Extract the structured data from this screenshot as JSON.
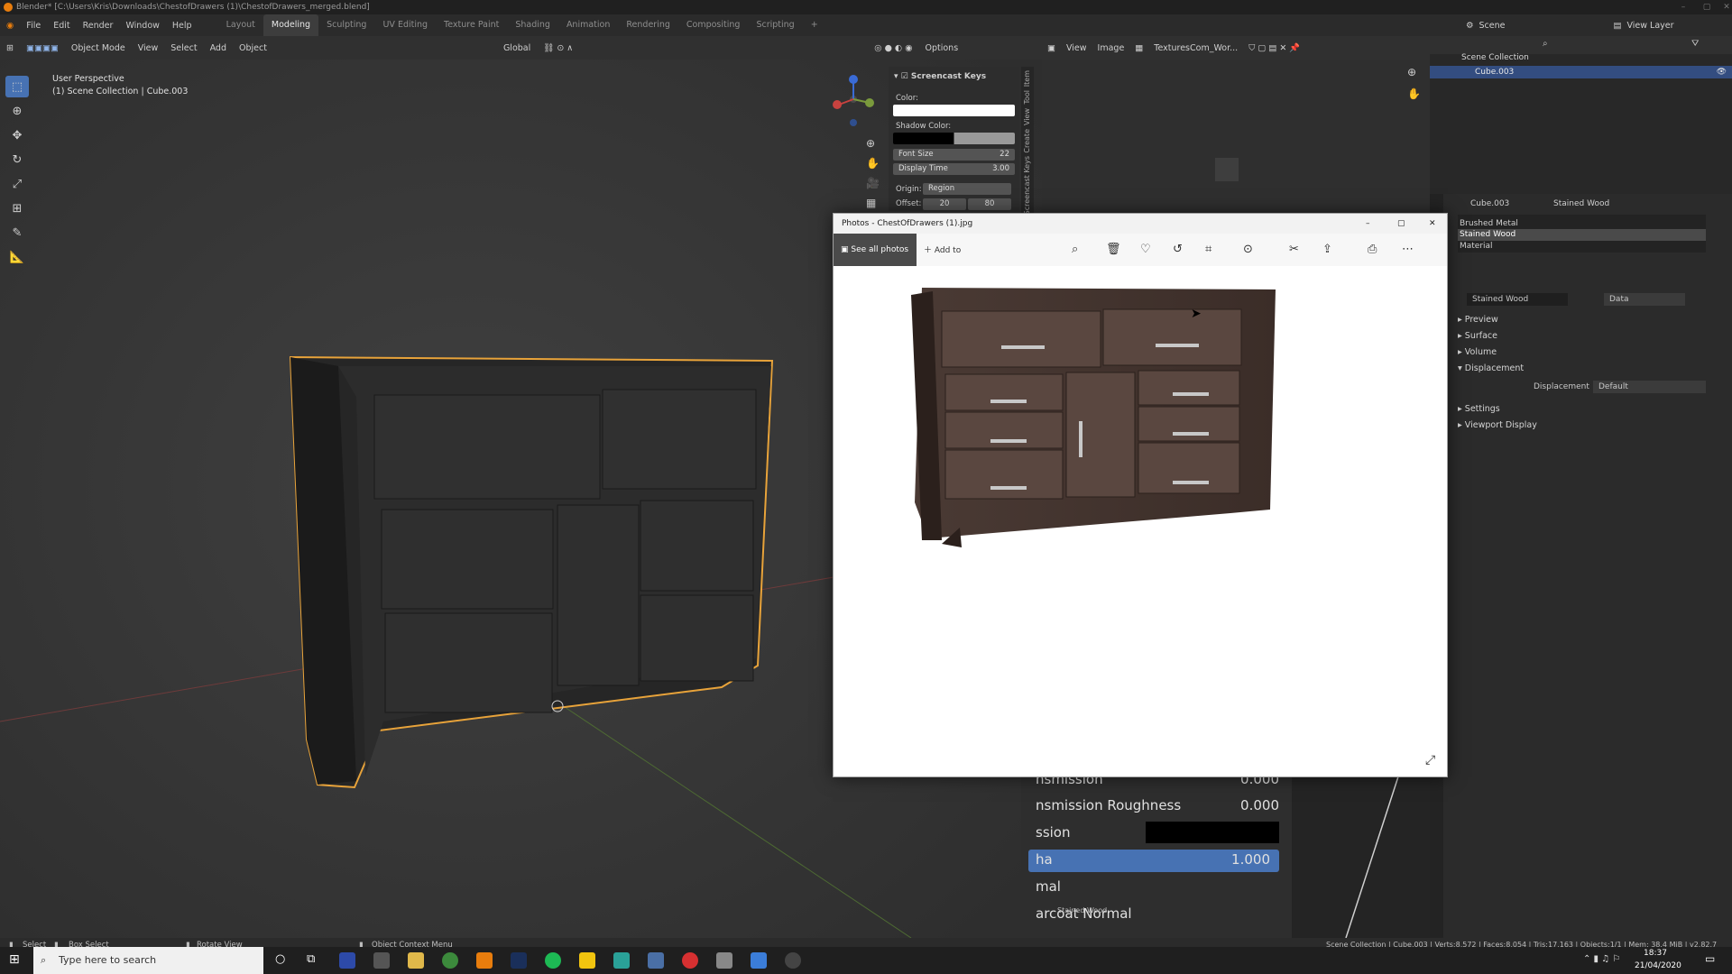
{
  "window": {
    "title": "Blender* [C:\\Users\\Kris\\Downloads\\ChestofDrawers (1)\\ChestofDrawers_merged.blend]"
  },
  "menubar": {
    "items": [
      "File",
      "Edit",
      "Render",
      "Window",
      "Help"
    ],
    "workspaces": [
      "Layout",
      "Modeling",
      "Sculpting",
      "UV Editing",
      "Texture Paint",
      "Shading",
      "Animation",
      "Rendering",
      "Compositing",
      "Scripting"
    ],
    "active_workspace": "Modeling",
    "add_tab": "+"
  },
  "scenebar": {
    "scene": "Scene",
    "view_layer": "View Layer"
  },
  "viewport": {
    "mode": "Object Mode",
    "menu": [
      "View",
      "Select",
      "Add",
      "Object"
    ],
    "orientation": "Global",
    "options": "Options",
    "perspective": "User Perspective",
    "collection": "(1) Scene Collection | Cube.003",
    "tools": [
      "select-box-icon",
      "cursor-icon",
      "move-icon",
      "rotate-icon",
      "scale-icon",
      "transform-icon",
      "annotate-icon",
      "measure-icon"
    ]
  },
  "npanel": {
    "title": "Screencast Keys",
    "color_label": "Color:",
    "shadow_label": "Shadow Color:",
    "font_size_label": "Font Size",
    "font_size": "22",
    "display_time_label": "Display Time",
    "display_time": "3.00",
    "origin_label": "Origin:",
    "origin": "Region",
    "offset_label": "Offset:",
    "offset_x": "20",
    "offset_y": "80",
    "tabs": [
      "Item",
      "Tool",
      "View",
      "Create",
      "Screencast Keys"
    ]
  },
  "image_editor": {
    "menu": [
      "View",
      "Image"
    ],
    "image_name": "TexturesCom_Wor..."
  },
  "outliner": {
    "scene_collection": "Scene Collection",
    "object": "Cube.003"
  },
  "properties": {
    "object": "Cube.003",
    "material": "Stained Wood",
    "slots": [
      "Brushed Metal",
      "Stained Wood",
      "Material"
    ],
    "material_field": "Stained Wood",
    "data_label": "Data",
    "sections": [
      "Preview",
      "Surface",
      "Volume",
      "Displacement",
      "Settings",
      "Viewport Display"
    ],
    "displacement_label": "Displacement",
    "displacement_value": "Default"
  },
  "shader": {
    "rows": [
      {
        "label": "nsmission",
        "value": "0.000"
      },
      {
        "label": "nsmission Roughness",
        "value": "0.000"
      },
      {
        "label": "ssion",
        "value": ""
      },
      {
        "label": "ha",
        "value": "1.000"
      },
      {
        "label": "mal",
        "value": ""
      },
      {
        "label": "arcoat Normal",
        "value": ""
      }
    ],
    "tooltip": "Stained Wood"
  },
  "photos": {
    "title": "Photos - ChestOfDrawers (1).jpg",
    "see_all": "See all photos",
    "add_to": "Add to"
  },
  "statusbar": {
    "select": "Select",
    "box_select": "Box Select",
    "rotate_view": "Rotate View",
    "context_menu": "Object Context Menu",
    "stats": "Scene Collection | Cube.003 | Verts:8,572 | Faces:8,054 | Tris:17,163 | Objects:1/1 | Mem: 38.4 MiB | v2.82.7"
  },
  "taskbar": {
    "search_placeholder": "Type here to search",
    "time": "18:37",
    "date": "21/04/2020"
  },
  "colors": {
    "accent": "#4772b3",
    "selection_outline": "#e8a33a",
    "blender_orange": "#e87d0d"
  }
}
